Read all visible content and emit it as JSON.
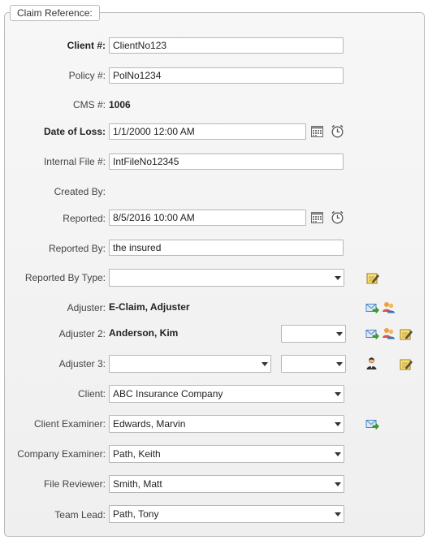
{
  "section": {
    "title": "Claim Reference:"
  },
  "fields": {
    "client_no": {
      "label": "Client #:",
      "value": "ClientNo123"
    },
    "policy_no": {
      "label": "Policy #:",
      "value": "PolNo1234"
    },
    "cms_no": {
      "label": "CMS #:",
      "value": "1006"
    },
    "date_of_loss": {
      "label": "Date of Loss:",
      "value": "1/1/2000 12:00 AM"
    },
    "internal_file": {
      "label": "Internal File #:",
      "value": "IntFileNo12345"
    },
    "created_by": {
      "label": "Created By:",
      "value": ""
    },
    "reported": {
      "label": "Reported:",
      "value": "8/5/2016 10:00 AM"
    },
    "reported_by": {
      "label": "Reported By:",
      "value": "the insured"
    },
    "reported_by_type": {
      "label": "Reported By Type:",
      "value": ""
    },
    "adjuster": {
      "label": "Adjuster:",
      "value": "E-Claim, Adjuster"
    },
    "adjuster2": {
      "label": "Adjuster 2:",
      "value": "Anderson, Kim",
      "role": ""
    },
    "adjuster3": {
      "label": "Adjuster 3:",
      "value": "",
      "role": ""
    },
    "client": {
      "label": "Client:",
      "value": "ABC Insurance Company"
    },
    "client_examiner": {
      "label": "Client Examiner:",
      "value": "Edwards, Marvin"
    },
    "company_examiner": {
      "label": "Company Examiner:",
      "value": "Path, Keith"
    },
    "file_reviewer": {
      "label": "File Reviewer:",
      "value": "Smith, Matt"
    },
    "team_lead": {
      "label": "Team Lead:",
      "value": "Path, Tony"
    }
  },
  "icons": {
    "calendar": "calendar-icon",
    "clock": "clock-icon",
    "edit": "edit-note-icon",
    "email": "email-forward-icon",
    "users": "users-icon",
    "person": "person-icon"
  },
  "colors": {
    "panel_border": "#b9b9b9",
    "email_green": "#3fa535",
    "email_blue": "#4a86c8",
    "note_yellow": "#f3d35c"
  }
}
